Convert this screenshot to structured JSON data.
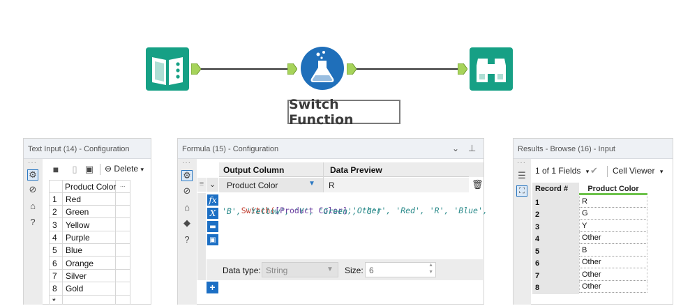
{
  "workflow": {
    "tools": [
      {
        "name": "Text Input",
        "icon": "book-icon",
        "color": "#16a085"
      },
      {
        "name": "Formula",
        "icon": "flask-icon",
        "color": "#1f6fba"
      },
      {
        "name": "Browse",
        "icon": "binoculars-icon",
        "color": "#16a085"
      }
    ],
    "label": "Switch Function"
  },
  "text_input_panel": {
    "title": "Text Input (14) - Configuration",
    "toolbar": {
      "delete_label": "Delete"
    },
    "column_header": "Product Color",
    "ellipsis": "...",
    "rows": [
      {
        "num": "1",
        "value": "Red"
      },
      {
        "num": "2",
        "value": "Green"
      },
      {
        "num": "3",
        "value": "Yellow"
      },
      {
        "num": "4",
        "value": "Purple"
      },
      {
        "num": "5",
        "value": "Blue"
      },
      {
        "num": "6",
        "value": "Orange"
      },
      {
        "num": "7",
        "value": "Silver"
      },
      {
        "num": "8",
        "value": "Gold"
      },
      {
        "num": "*",
        "value": ""
      }
    ]
  },
  "formula_panel": {
    "title": "Formula (15) - Configuration",
    "output_column_header": "Output Column",
    "data_preview_header": "Data Preview",
    "output_column_value": "Product Color",
    "data_preview_value": "R",
    "expression_line1": {
      "fn": "Switch(",
      "field": "[Product Color]",
      "rest": ",'Other', 'Red', 'R', 'Blue',"
    },
    "expression_line2": "'B', 'Yellow', 'Y', 'Green', 'G')",
    "data_type_label": "Data type:",
    "data_type_value": "String",
    "size_label": "Size:",
    "size_value": "6"
  },
  "results_panel": {
    "title": "Results - Browse (16) - Input",
    "fields_label": "1 of 1 Fields",
    "viewer_label": "Cell Viewer",
    "record_header": "Record #",
    "column_header": "Product Color",
    "rows": [
      {
        "num": "1",
        "value": "R"
      },
      {
        "num": "2",
        "value": "G"
      },
      {
        "num": "3",
        "value": "Y"
      },
      {
        "num": "4",
        "value": "Other"
      },
      {
        "num": "5",
        "value": "B"
      },
      {
        "num": "6",
        "value": "Other"
      },
      {
        "num": "7",
        "value": "Other"
      },
      {
        "num": "8",
        "value": "Other"
      }
    ]
  }
}
